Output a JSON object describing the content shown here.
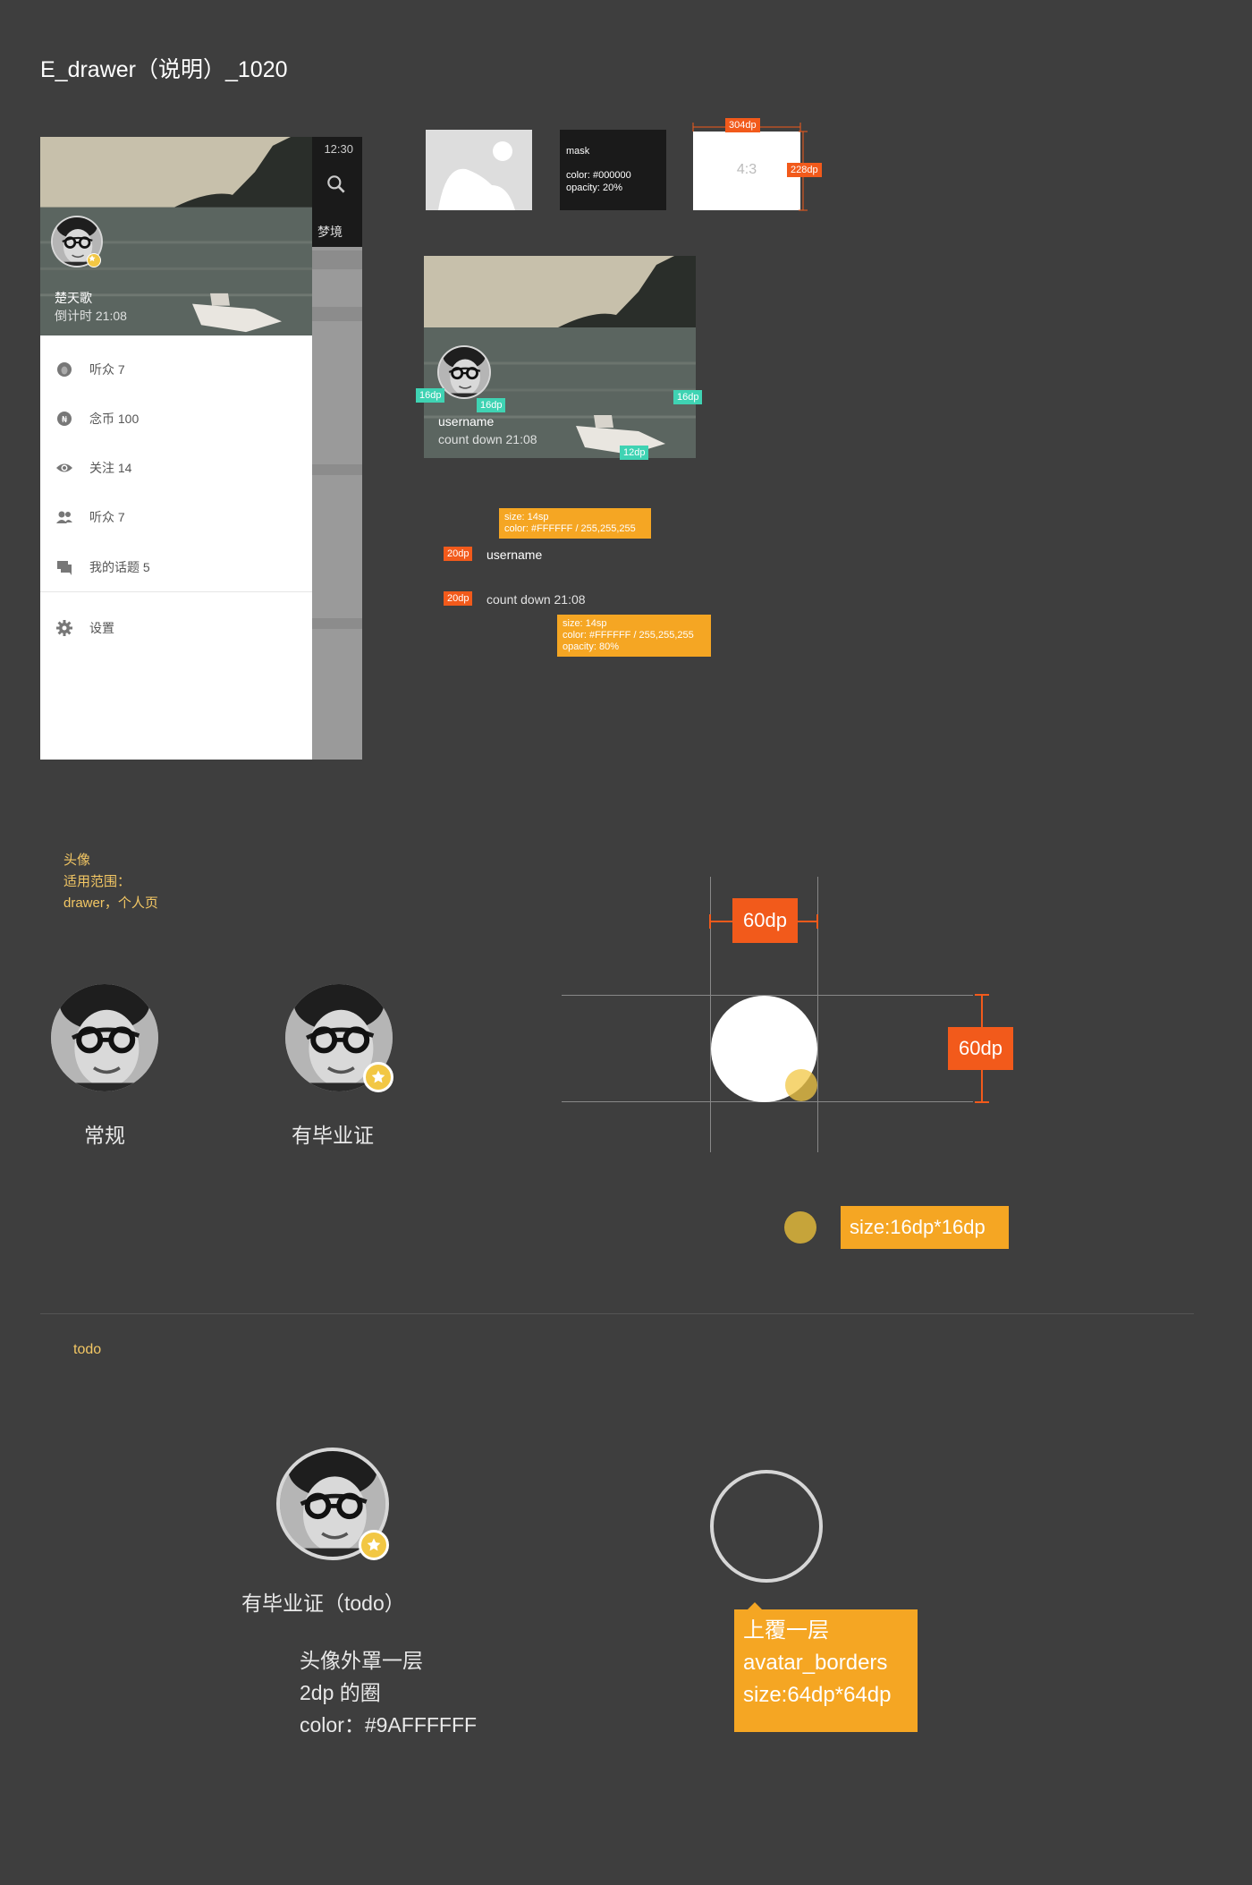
{
  "page": {
    "title": "E_drawer（说明）_1020"
  },
  "drawer": {
    "status_time": "12:30",
    "behind_tab": "梦境",
    "username": "楚天歌",
    "countdown": "倒计时  21:08",
    "menu": [
      {
        "icon": "egg-icon",
        "label": "听众 7"
      },
      {
        "icon": "coin-icon",
        "label": "念币 100"
      },
      {
        "icon": "eye-icon",
        "label": "关注 14"
      },
      {
        "icon": "people-icon",
        "label": "听众 7"
      },
      {
        "icon": "chat-icon",
        "label": "我的话题 5"
      },
      {
        "icon": "gear-icon",
        "label": "设置"
      }
    ]
  },
  "specs": {
    "mask": {
      "title": "mask",
      "color": "color: #000000",
      "opacity": "opacity: 20%"
    },
    "ratio": {
      "label": "4:3",
      "width_tag": "304dp",
      "height_tag": "228dp"
    },
    "sample": {
      "username": "username",
      "countdown": "count down 21:08",
      "tag_left": "16dp",
      "tag_avatar": "16dp",
      "tag_right": "16dp",
      "tag_bottom": "12dp"
    },
    "type_username": {
      "indent": "20dp",
      "label": "username",
      "size": "size: 14sp",
      "color": "color: #FFFFFF / 255,255,255"
    },
    "type_countdown": {
      "indent": "20dp",
      "label": "count down 21:08",
      "size": "size: 14sp",
      "color": "color: #FFFFFF / 255,255,255",
      "opacity": "opacity: 80%"
    }
  },
  "avatar_section": {
    "note_title": "头像",
    "note_scope": "适用范围：",
    "note_pages": "drawer，个人页",
    "normal_label": "常规",
    "graduate_label": "有毕业证",
    "width_tag": "60dp",
    "height_tag": "60dp",
    "badge_size": "size:16dp*16dp"
  },
  "todo_section": {
    "label": "todo",
    "avatar_label": "有毕业证（todo）",
    "note_line1": "头像外罩一层",
    "note_line2": "2dp 的圈",
    "note_line3": "color：#9AFFFFFF",
    "layer_line1": "上覆一层",
    "layer_line2": "avatar_borders",
    "layer_line3": "size:64dp*64dp"
  },
  "colors": {
    "accent_red": "#f25a1b",
    "accent_orange": "#f5a623",
    "accent_teal": "#3fd3b3",
    "badge_yellow": "#f2c744"
  }
}
